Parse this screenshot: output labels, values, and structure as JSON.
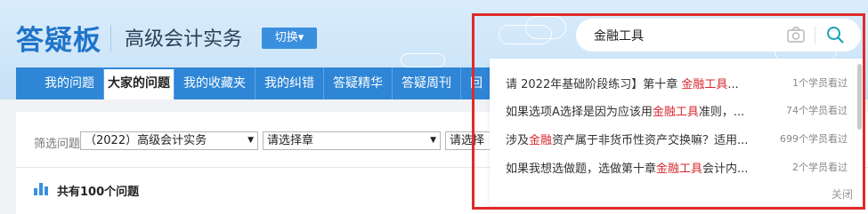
{
  "header": {
    "logo": "答疑板",
    "subject": "高级会计实务",
    "switch_label": "切换▾"
  },
  "nav": {
    "items": [
      {
        "label": "我的问题",
        "active": false
      },
      {
        "label": "大家的问题",
        "active": true
      },
      {
        "label": "我的收藏夹",
        "active": false
      },
      {
        "label": "我的纠错",
        "active": false
      },
      {
        "label": "答疑精华",
        "active": false
      },
      {
        "label": "答疑周刊",
        "active": false
      },
      {
        "label": "回",
        "active": false
      }
    ]
  },
  "filter": {
    "label": "筛选问题",
    "selects": [
      {
        "value": "（2022）高级会计实务"
      },
      {
        "value": "请选择章"
      },
      {
        "value": "请选择"
      }
    ]
  },
  "summary": {
    "count_text": "共有100个问题"
  },
  "search": {
    "value": "金融工具",
    "icons": [
      "camera-icon",
      "search-icon"
    ],
    "accent_color": "#1aa3b5",
    "highlight_color": "#d9282f",
    "results": [
      {
        "pre": "请 2022年基础阶段练习】第十章 ",
        "hl": "金融工具",
        "post": "...",
        "meta": "1个学员看过"
      },
      {
        "pre": "如果选项A选择是因为应该用",
        "hl": "金融工具",
        "post": "准则，...",
        "meta": "74个学员看过"
      },
      {
        "pre": "涉及",
        "hl": "金融",
        "post": "资产属于非货币性资产交换嘛？适用...",
        "meta": "699个学员看过"
      },
      {
        "pre": "如果我想选做题，选做第十章",
        "hl": "金融工具",
        "post": "会计内...",
        "meta": "2个学员看过"
      }
    ],
    "close_label": "关闭"
  }
}
